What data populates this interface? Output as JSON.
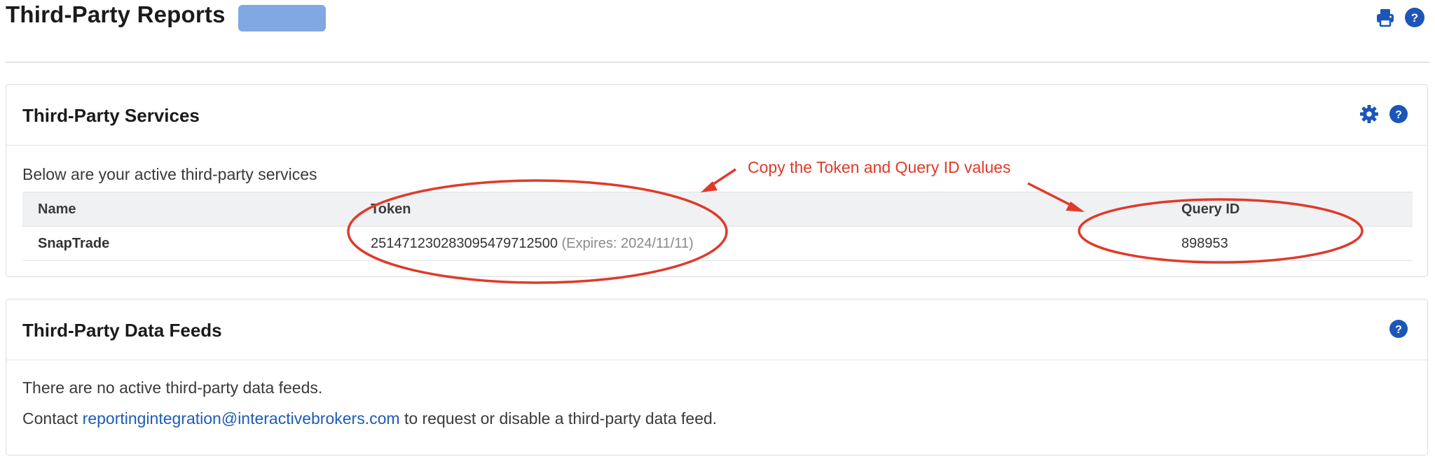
{
  "page": {
    "title": "Third-Party Reports"
  },
  "toolbar": {
    "print_icon": "print-icon",
    "help_icon": "help-icon"
  },
  "services": {
    "title": "Third-Party Services",
    "intro": "Below are your active third-party services",
    "columns": [
      "Name",
      "Token",
      "Query ID"
    ],
    "rows": [
      {
        "name": "SnapTrade",
        "token": "251471230283095479712500",
        "expires": "(Expires: 2024/11/11)",
        "query_id": "898953"
      }
    ]
  },
  "feeds": {
    "title": "Third-Party Data Feeds",
    "empty_text": "There are no active third-party data feeds.",
    "contact_prefix": "Contact",
    "contact_email": "reportingintegration@interactivebrokers.com",
    "contact_suffix": "to request or disable a third-party data feed."
  },
  "annotation": {
    "text": "Copy the Token and Query ID values",
    "color": "#e03a2a"
  },
  "colors": {
    "accent": "#1d56b8",
    "chip": "#82a8e4"
  }
}
